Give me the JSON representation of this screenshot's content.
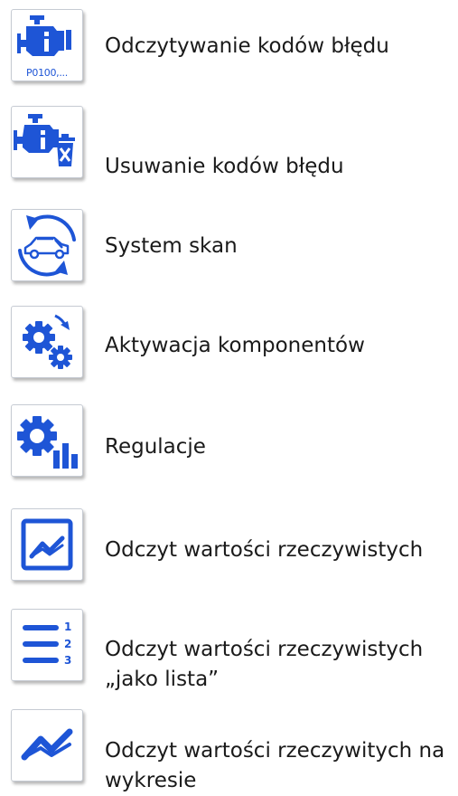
{
  "menu": {
    "items": [
      {
        "label": "Odczytywanie kodów błędu",
        "icon": "engine-code-icon",
        "icon_caption": "P0100,..."
      },
      {
        "label": "Usuwanie kodów błędu",
        "icon": "engine-delete-icon"
      },
      {
        "label": "System skan",
        "icon": "car-scan-icon"
      },
      {
        "label": "Aktywacja komponentów",
        "icon": "gears-rotate-icon"
      },
      {
        "label": "Regulacje",
        "icon": "gear-bars-icon"
      },
      {
        "label": "Odczyt wartości rzeczywistych",
        "icon": "chart-frame-icon"
      },
      {
        "label": "Odczyt wartości rzeczywistych „jako lista”",
        "icon": "numbered-list-icon"
      },
      {
        "label": "Odczyt wartości rzeczywitych na wykresie",
        "icon": "trend-chart-icon"
      }
    ]
  },
  "colors": {
    "accent": "#1e55d6",
    "text": "#1a1a1a",
    "tile_border": "#c6cbd3"
  }
}
